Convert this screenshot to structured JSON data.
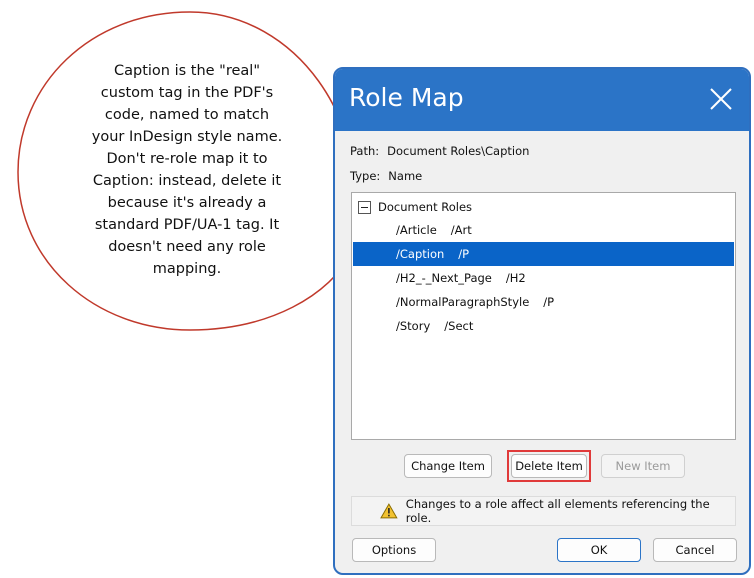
{
  "callout": {
    "lines": [
      "Caption is the \"real\"",
      "custom tag in the PDF's",
      "code, named to match",
      "your InDesign style name.",
      "Don't re-role map it to",
      "Caption: instead, delete it",
      "because it's already a",
      "standard PDF/UA-1 tag. It",
      "doesn't need any role",
      "mapping."
    ]
  },
  "dialog": {
    "title": "Role Map",
    "path_label": "Path:",
    "path_value": "Document Roles\\Caption",
    "type_label": "Type:",
    "type_value": "Name",
    "tree": {
      "root": "Document Roles",
      "items": [
        {
          "name": "/Article",
          "role": "/Art",
          "selected": false
        },
        {
          "name": "/Caption",
          "role": "/P",
          "selected": true
        },
        {
          "name": "/H2_-_Next_Page",
          "role": "/H2",
          "selected": false
        },
        {
          "name": "/NormalParagraphStyle",
          "role": "/P",
          "selected": false
        },
        {
          "name": "/Story",
          "role": "/Sect",
          "selected": false
        }
      ]
    },
    "buttons": {
      "change_item": "Change Item",
      "delete_item": "Delete Item",
      "new_item": "New Item",
      "options": "Options",
      "ok": "OK",
      "cancel": "Cancel"
    },
    "warning": "Changes to a role affect all elements referencing the role.",
    "colors": {
      "titlebar": "#2b74c7",
      "selection": "#0a64c8",
      "highlight": "#e03a3a",
      "callout_border": "#c0392b"
    }
  }
}
